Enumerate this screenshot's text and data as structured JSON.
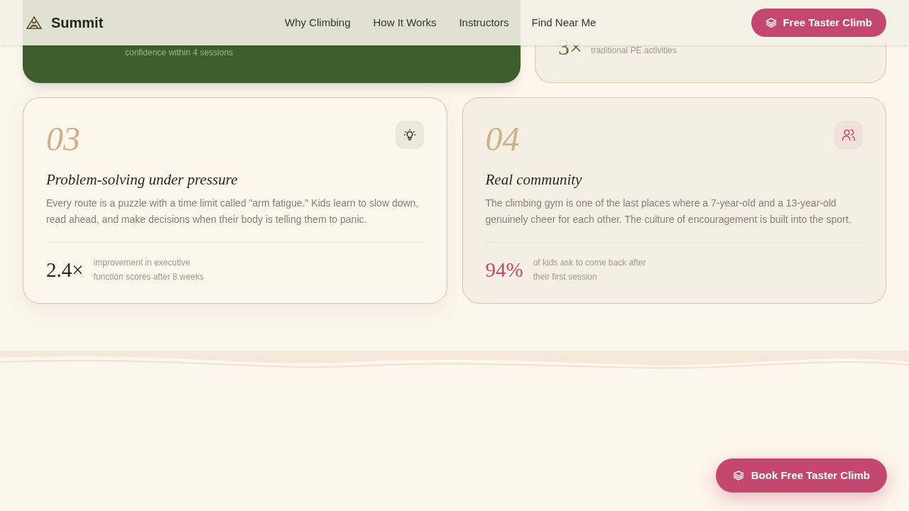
{
  "header": {
    "logo": "Summit",
    "nav": [
      "Why Climbing",
      "How It Works",
      "Instructors",
      "Find Near Me"
    ],
    "cta": "Free Taster Climb"
  },
  "top_cards": [
    {
      "kind": "dark",
      "caption": "confidence within 4 sessions"
    },
    {
      "kind": "light",
      "stat": "3×",
      "caption": "traditional PE activities"
    }
  ],
  "cards": [
    {
      "kind": "light",
      "number": "03",
      "title": "Problem-solving under pressure",
      "body": "Every route is a puzzle with a time limit called \"arm fatigue.\" Kids learn to slow down, read ahead, and make decisions when their body is telling them to panic.",
      "stat": "2.4×",
      "caption": [
        "improvement in executive",
        "function scores after 8 weeks"
      ]
    },
    {
      "kind": "tinted",
      "number": "04",
      "title": "Real community",
      "body": "The climbing gym is one of the last places where a 7-year-old and a 13-year-old genuinely cheer for each other. The culture of encouragement is built into the sport.",
      "stat": "94%",
      "caption": [
        "of kids ask to come back after",
        "their first session"
      ]
    }
  ],
  "floating_cta": "Book Free Taster Climb"
}
